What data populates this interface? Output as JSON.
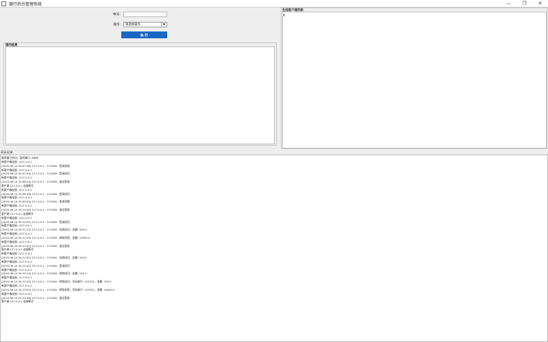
{
  "window": {
    "title": "银行后台管理系统",
    "controls": [
      "—",
      "❐",
      "✕"
    ]
  },
  "form": {
    "account_label": "帐号:",
    "account_value": "",
    "operation_label": "操作:",
    "operation_selected": "请选择操作...",
    "execute_label": "执 行"
  },
  "result_panel": {
    "title": "操作结果",
    "content": ""
  },
  "online_panel": {
    "title": "在线客户端列表"
  },
  "log_panel": {
    "title": "日志记录",
    "lines": [
      "服务器已启动，监听端口: 8888",
      "新客户端连接: /127.0.0.1",
      "[2025-06-14 20:07:48] 127.0.0.1 - 123456 - 登录失败",
      "新客户端连接: /127.0.0.1",
      "[2025-06-14 20:07:54] 127.0.0.1 - 123456 - 登录成功",
      "新客户端连接: /127.0.0.1",
      "[2025-06-14 20:08:24] 127.0.0.1 - 123456 - 退出登录",
      "客户端 127.0.0.1 连接断开",
      "新客户端连接: /127.0.0.1",
      "[2025-06-14 20:08:28] 127.0.0.1 - 123456 - 登录成功",
      "新客户端连接: /127.0.0.1",
      "[2025-06-14 20:09:24] 127.0.0.1 - 123456 - 查询余额",
      "新客户端连接: /127.0.0.1",
      "[2025-06-14 20:10:04] 127.0.0.1 - 123456 - 退出登录",
      "客户端 127.0.0.1 连接断开",
      "新客户端连接: /127.0.0.1",
      "[2025-06-14 20:10:51] 127.0.0.1 - 123456 - 登录成功",
      "新客户端连接: /127.0.0.1",
      "[2025-06-14 20:11:12] 127.0.0.1 - 123456 - 存款成功，金额: 500.0",
      "新客户端连接: /127.0.0.1",
      "[2025-06-14 20:11:29] 127.0.0.1 - 123456 - 取款失败，金额: 10000.0",
      "新客户端连接: /127.0.0.1",
      "[2025-06-14 20:11:51] 127.0.0.1 - 123456 - 退出登录",
      "客户端 127.0.0.1 连接断开",
      "新客户端连接: /127.0.0.1",
      "[2025-06-14 20:11:51] 127.0.0.1 - 123456 - 存款成功，金额: 100.0",
      "新客户端连接: /127.0.0.1",
      "[2025-06-14 20:12:02] 127.0.0.1 - 123456 - 登录成功",
      "新客户端连接: /127.0.0.1",
      "[2025-06-14 20:12:14] 127.0.0.1 - 123456 - 取款成功，金额: 100.0",
      "新客户端连接: /127.0.0.1",
      "[2025-06-14 20:12:42] 127.0.0.1 - 123456 - 转账成功，目标账户: 123321，金额: 100.0",
      "新客户端连接: /127.0.0.1",
      "[2025-06-14 20:13:02] 127.0.0.1 - 123456 - 转账失败，目标账户: 123321，金额: 10000.0",
      "新客户端连接: /127.0.0.1",
      "[2025-06-14 20:13:38] 127.0.0.1 - 123456 - 退出登录",
      "客户端 127.0.0.1 连接断开"
    ]
  }
}
